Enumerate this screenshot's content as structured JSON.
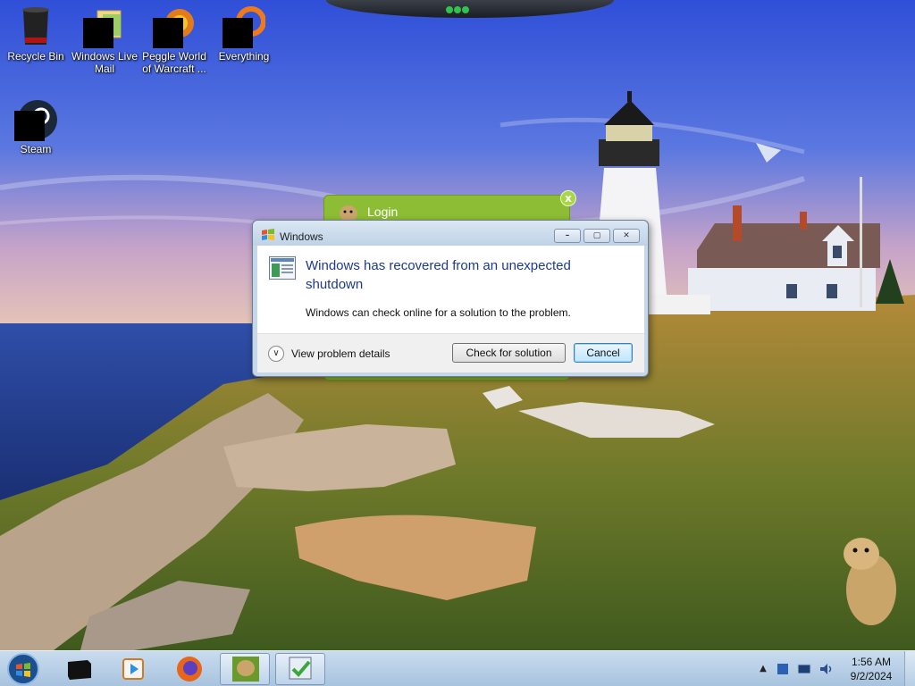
{
  "desktop": {
    "icons": [
      {
        "label": "Recycle Bin"
      },
      {
        "label": "Windows Live Mail"
      },
      {
        "label": "Peggle World of Warcraft ..."
      },
      {
        "label": "Everything"
      },
      {
        "label": "Steam"
      }
    ]
  },
  "login_gadget": {
    "title": "Login",
    "close_glyph": "x"
  },
  "dialog": {
    "title": "Windows",
    "heading": "Windows has recovered from an unexpected shutdown",
    "subtext": "Windows can check online for a solution to the problem.",
    "details_label": "View problem details",
    "check_button": "Check for solution",
    "cancel_button": "Cancel",
    "minimize_glyph": "–",
    "maximize_glyph": "▢",
    "close_glyph": "✕"
  },
  "taskbar": {
    "items": [
      "start-orb-icon",
      "black-box-icon",
      "media-player-icon",
      "firefox-icon",
      "hamster-box-icon",
      "check-app-icon"
    ],
    "clock": {
      "time": "1:56 AM",
      "date": "9/2/2024"
    }
  },
  "colors": {
    "dialog_heading": "#1e3a8a",
    "gadget_green": "#8dbd34",
    "taskbar": "#b8cfe6"
  }
}
